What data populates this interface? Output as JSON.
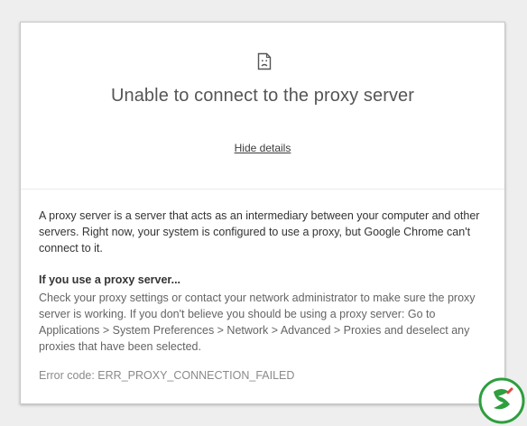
{
  "error_page": {
    "icon": "sad-page-icon",
    "title": "Unable to connect to the proxy server",
    "toggle_label": "Hide details",
    "intro": "A proxy server is a server that acts as an intermediary between your computer and other servers. Right now, your system is configured to use a proxy, but Google Chrome can't connect to it.",
    "subhead": "If you use a proxy server...",
    "advice": "Check your proxy settings or contact your network administrator to make sure the proxy server is working. If you don't believe you should be using a proxy server: Go to Applications > System Preferences > Network > Advanced > Proxies and deselect any proxies that have been selected.",
    "error_code": "Error code: ERR_PROXY_CONNECTION_FAILED"
  },
  "watermark": {
    "icon": "brand-logo-icon",
    "colors": {
      "primary": "#2e9e3e",
      "secondary": "#e04848"
    }
  }
}
